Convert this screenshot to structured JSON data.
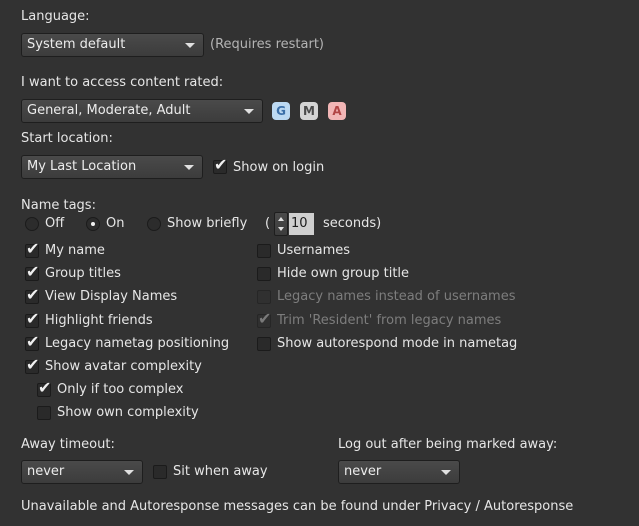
{
  "language": {
    "label": "Language:",
    "value": "System default",
    "note": "(Requires restart)"
  },
  "content_rating": {
    "label": "I want to access content rated:",
    "value": "General, Moderate, Adult",
    "badges": {
      "g": "G",
      "m": "M",
      "a": "A"
    },
    "colors": {
      "g": "#bcd9f2",
      "m": "#d4d4d4",
      "a": "#f2b6b6"
    }
  },
  "start_location": {
    "label": "Start location:",
    "value": "My Last Location",
    "show_on_login": {
      "label": "Show on login",
      "checked": true
    }
  },
  "name_tags": {
    "label": "Name tags:",
    "radios": [
      {
        "label": "Off",
        "selected": false
      },
      {
        "label": "On",
        "selected": true
      },
      {
        "label": "Show briefly",
        "selected": false
      }
    ],
    "paren_open": "(",
    "seconds_value": "10",
    "seconds_label": "seconds)"
  },
  "left_checks": [
    {
      "label": "My name",
      "checked": true
    },
    {
      "label": "Group titles",
      "checked": true
    },
    {
      "label": "View Display Names",
      "checked": true
    },
    {
      "label": "Highlight friends",
      "checked": true
    },
    {
      "label": "Legacy nametag positioning",
      "checked": true
    },
    {
      "label": "Show avatar complexity",
      "checked": true
    },
    {
      "label": "Only if too complex",
      "checked": true
    },
    {
      "label": "Show own complexity",
      "checked": false
    }
  ],
  "right_checks": [
    {
      "label": "Usernames",
      "checked": false,
      "disabled": false
    },
    {
      "label": "Hide own group title",
      "checked": false,
      "disabled": false
    },
    {
      "label": "Legacy names instead of usernames",
      "checked": false,
      "disabled": true
    },
    {
      "label": "Trim 'Resident' from legacy names",
      "checked": true,
      "disabled": true
    },
    {
      "label": "Show autorespond mode in nametag",
      "checked": false,
      "disabled": false
    }
  ],
  "away": {
    "label": "Away timeout:",
    "value": "never",
    "sit_when_away": {
      "label": "Sit when away",
      "checked": false
    }
  },
  "logout": {
    "label": "Log out after being marked away:",
    "value": "never"
  },
  "footer": "Unavailable and Autoresponse messages can be found under Privacy / Autoresponse",
  "glyphs": {
    "check": "✔"
  }
}
